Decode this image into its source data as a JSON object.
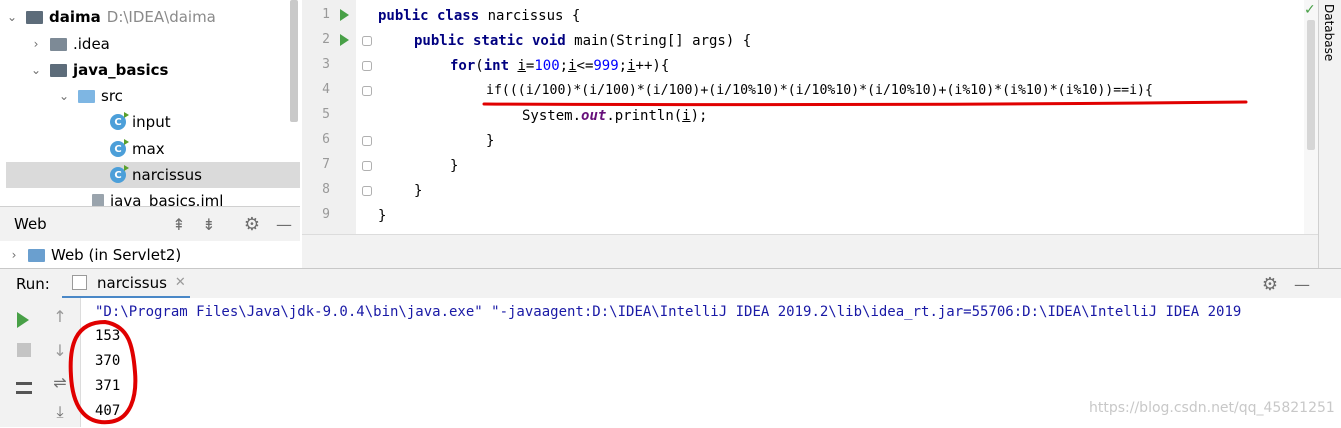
{
  "project": {
    "items": [
      {
        "name": "daima",
        "path": "D:\\IDEA\\daima"
      },
      {
        "name": ".idea"
      },
      {
        "name": "java_basics"
      },
      {
        "name": "src"
      },
      {
        "name": "input"
      },
      {
        "name": "max"
      },
      {
        "name": "narcissus"
      },
      {
        "name": "java_basics.iml"
      }
    ]
  },
  "web": {
    "title": "Web",
    "item": "Web (in Servlet2)"
  },
  "editor": {
    "line_numbers": [
      "1",
      "2",
      "3",
      "4",
      "5",
      "6",
      "7",
      "8",
      "9"
    ],
    "lines": {
      "l1a": "public class",
      "l1b": " narcissus {",
      "l2a": "public static void",
      "l2b": " main(String[] args) {",
      "l3a": "for",
      "l3b": "(",
      "l3c": "int",
      "l3d": " ",
      "l3e": "i",
      "l3f": "=",
      "l3g": "100",
      "l3h": ";",
      "l3i": "i",
      "l3j": "<=",
      "l3k": "999",
      "l3l": ";",
      "l3m": "i",
      "l3n": "++){",
      "l4": "if(((i/100)*(i/100)*(i/100)+(i/10%10)*(i/10%10)*(i/10%10)+(i%10)*(i%10)*(i%10))==i){",
      "l5a": "System.",
      "l5b": "out",
      "l5c": ".println(",
      "l5d": "i",
      "l5e": ");",
      "l6": "}",
      "l7": "}",
      "l8": "}",
      "l9": "}"
    }
  },
  "sidebar_right": {
    "label": "Database"
  },
  "run": {
    "label": "Run:",
    "tab": "narcissus",
    "command": "\"D:\\Program Files\\Java\\jdk-9.0.4\\bin\\java.exe\" \"-javaagent:D:\\IDEA\\IntelliJ IDEA 2019.2\\lib\\idea_rt.jar=55706:D:\\IDEA\\IntelliJ IDEA 2019",
    "output": [
      "153",
      "370",
      "371",
      "407"
    ]
  },
  "watermark": "https://blog.csdn.net/qq_45821251",
  "colors": {
    "accent_red": "#e00000",
    "run_green": "#48a047",
    "keyword": "#000080",
    "number": "#0000ff"
  }
}
